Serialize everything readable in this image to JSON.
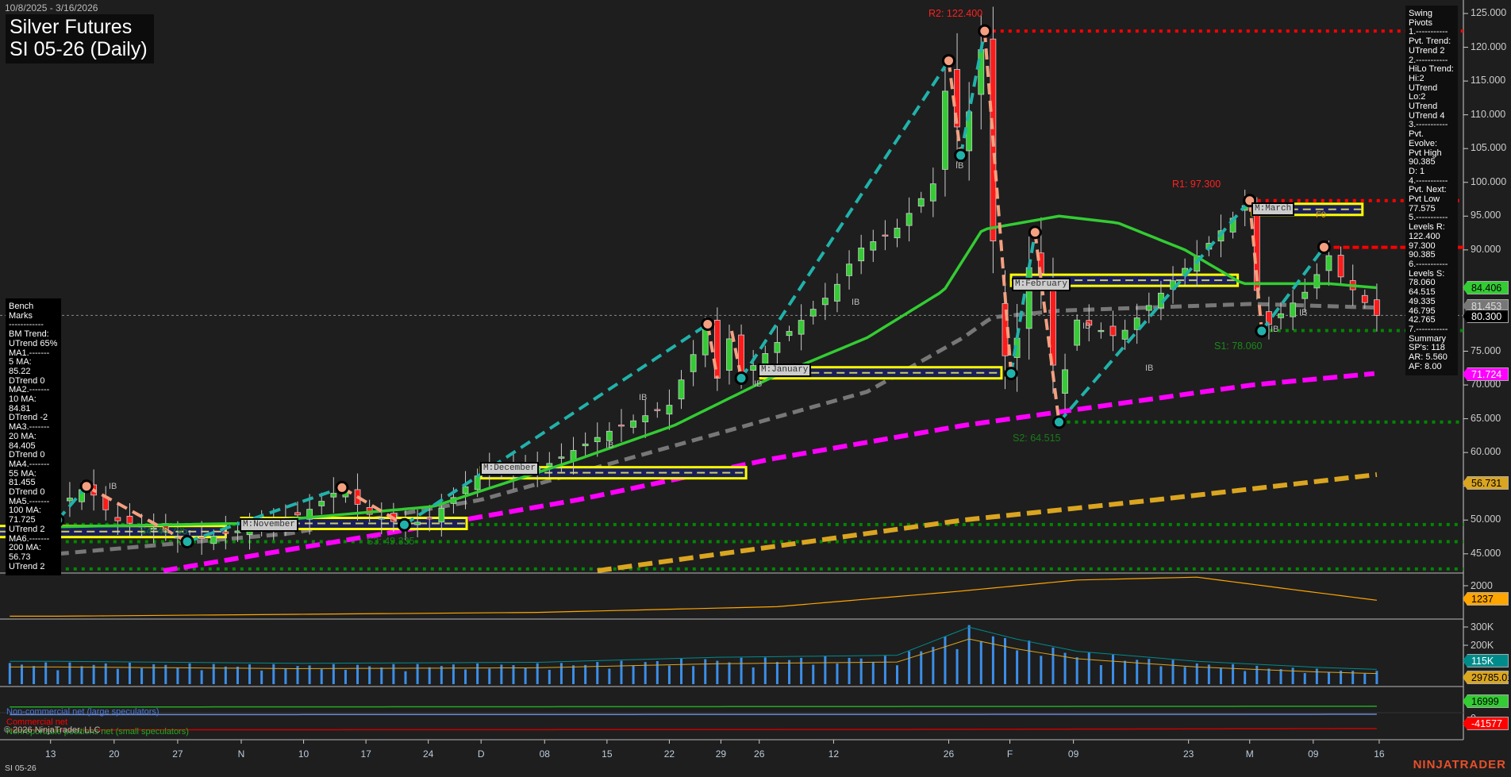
{
  "header": {
    "date_range": "10/8/2025 - 3/16/2026",
    "title": "Silver Futures",
    "subtitle": "SI 05-26 (Daily)"
  },
  "swing_pivots": [
    "Swing Pivots",
    "1.-----------",
    "Pvt. Trend:",
    "UTrend 2",
    "2.-----------",
    "HiLo Trend:",
    "Hi:2 UTrend",
    "Lo:2 UTrend",
    "UTrend 4",
    "3.-----------",
    "Pvt. Evolve:",
    "Pvt High",
    "90.385",
    "D: 1",
    "4.-----------",
    "Pvt. Next:",
    "Pvt Low",
    "77.575",
    "5.-----------",
    "Levels R:",
    "122.400",
    "97.300",
    "90.385",
    "6.-----------",
    "Levels S:",
    "78.060",
    "64.515",
    "49.335",
    "46.795",
    "42.765",
    "7.-----------",
    "Summary",
    "SP's: 118",
    "AR: 5.560",
    "AF: 8.00"
  ],
  "bench_marks": [
    "Bench Marks",
    "------------",
    "BM Trend:",
    "UTrend 65%",
    "MA1.-------",
    "5 MA:",
    "85.22",
    "DTrend 0",
    "MA2.-------",
    "10 MA:",
    "84.81",
    "DTrend -2",
    "MA3.-------",
    "20 MA:",
    "84.405",
    "DTrend 0",
    "MA4.-------",
    "55 MA:",
    "81.455",
    "DTrend 0",
    "MA5.-------",
    "100 MA:",
    "71.725",
    "UTrend 2",
    "MA6.-------",
    "200 MA:",
    "56.73",
    "UTrend 2"
  ],
  "level_labels": {
    "r2": "R2: 122.400",
    "r1": "R1: 97.300",
    "s1": "S1: 78.060",
    "s2": "S2: 64.515",
    "s3": "S3: 49.335",
    "s4": "S4: 46.795"
  },
  "month_boxes": {
    "nov": "M:November",
    "dec": "M:December",
    "jan": "M:January",
    "feb": "M:February",
    "mar": "M:March",
    "f0": "F0"
  },
  "ib_label": "IB",
  "price_axis": [
    "125.000",
    "120.000",
    "115.000",
    "110.000",
    "105.000",
    "100.000",
    "95.000",
    "90.000",
    "75.000",
    "70.000",
    "65.000",
    "60.000",
    "55.000",
    "50.000",
    "45.000"
  ],
  "indicator_axis": [
    "2000"
  ],
  "volume_axis": [
    "300K",
    "200K"
  ],
  "cot_axis": [
    "0"
  ],
  "price_tags": {
    "ma20": "84.406",
    "ma55": "81.453",
    "last": "80.300",
    "ma100": "71.724",
    "ma200": "56.731",
    "ind": "1237",
    "vol": "115K",
    "volavg": "29785.01",
    "nonrep": "16999",
    "comm": "-41577"
  },
  "legend": {
    "noncomm": "Non-commercial net (large speculators)",
    "comm": "Commercial net",
    "copyright": "© 2026 NinjaTrader, LLC",
    "nonrep": "Nonreportable positions net (small speculators)"
  },
  "x_axis": [
    {
      "i": -0.6,
      "t": "13"
    },
    {
      "i": 4.7,
      "t": "20"
    },
    {
      "i": 10,
      "t": "27"
    },
    {
      "i": 15.3,
      "t": "N"
    },
    {
      "i": 20.5,
      "t": "10"
    },
    {
      "i": 25.7,
      "t": "17"
    },
    {
      "i": 30.9,
      "t": "24"
    },
    {
      "i": 35.3,
      "t": "D"
    },
    {
      "i": 40.6,
      "t": "08"
    },
    {
      "i": 45.8,
      "t": "15"
    },
    {
      "i": 51,
      "t": "22"
    },
    {
      "i": 55.3,
      "t": "29"
    },
    {
      "i": 58.5,
      "t": "26"
    },
    {
      "i": 64.7,
      "t": "12"
    },
    {
      "i": 74.3,
      "t": "26"
    },
    {
      "i": 79.4,
      "t": "F"
    },
    {
      "i": 84.7,
      "t": "09"
    },
    {
      "i": 94.3,
      "t": "23"
    },
    {
      "i": 99.4,
      "t": "M"
    },
    {
      "i": 104.7,
      "t": "09"
    },
    {
      "i": 110.2,
      "t": "16"
    }
  ],
  "footer": {
    "instrument": "SI 05-26",
    "brand": "NINJATRADER"
  },
  "colors": {
    "up": "#33cc33",
    "down": "#ff1a1a",
    "ma20": "#33cc33",
    "ma55": "#777777",
    "ma100": "#ff00ff",
    "ma200": "#daa520",
    "swing_up": "#20b2aa",
    "swing_down": "#f4a080",
    "resistance": "#ff0000",
    "support": "#008800"
  },
  "chart_data": {
    "type": "candlestick",
    "title": "Silver Futures SI 05-26 (Daily)",
    "x_unit": "trading-day index from 10/8/2025",
    "ylim": [
      42,
      127
    ],
    "price_path": [
      [
        0,
        52
      ],
      [
        2.4,
        55
      ],
      [
        4.7,
        50
      ],
      [
        8.8,
        48.5
      ],
      [
        10,
        47.5
      ],
      [
        10.8,
        46.8
      ],
      [
        15.3,
        48.5
      ],
      [
        20.5,
        51
      ],
      [
        23.7,
        54.8
      ],
      [
        25.7,
        51
      ],
      [
        28.9,
        49.3
      ],
      [
        30.9,
        50
      ],
      [
        35.3,
        57
      ],
      [
        40.6,
        58
      ],
      [
        45.8,
        63
      ],
      [
        51,
        67
      ],
      [
        54.2,
        79
      ],
      [
        55,
        71
      ],
      [
        56.2,
        78
      ],
      [
        57,
        71
      ],
      [
        58.6,
        74
      ],
      [
        64.7,
        84
      ],
      [
        66.7,
        90
      ],
      [
        69.9,
        93
      ],
      [
        73.1,
        100
      ],
      [
        74.3,
        118
      ],
      [
        75.3,
        104
      ],
      [
        77.3,
        122.4
      ],
      [
        78.3,
        78
      ],
      [
        79.5,
        71.7
      ],
      [
        81.5,
        92.6
      ],
      [
        82.7,
        78
      ],
      [
        83.5,
        64.5
      ],
      [
        84.5,
        80
      ],
      [
        88.4,
        77
      ],
      [
        94.4,
        88
      ],
      [
        99.4,
        97.3
      ],
      [
        99.6,
        90
      ],
      [
        100.4,
        78
      ],
      [
        104.8,
        85
      ],
      [
        105.6,
        90.4
      ],
      [
        107,
        86
      ],
      [
        110,
        80.3
      ]
    ],
    "ma20": [
      [
        0,
        49
      ],
      [
        15.3,
        49.5
      ],
      [
        31.3,
        52
      ],
      [
        43.4,
        59
      ],
      [
        51.4,
        64
      ],
      [
        59.4,
        71
      ],
      [
        67.5,
        77
      ],
      [
        73.9,
        84
      ],
      [
        77.1,
        93
      ],
      [
        83.5,
        95
      ],
      [
        88.4,
        94
      ],
      [
        94,
        90
      ],
      [
        98.8,
        85
      ],
      [
        106,
        85
      ],
      [
        110,
        84.4
      ]
    ],
    "ma55": [
      [
        0,
        45
      ],
      [
        19.3,
        48
      ],
      [
        35.3,
        53
      ],
      [
        51.4,
        61
      ],
      [
        67.5,
        69
      ],
      [
        75.5,
        77
      ],
      [
        77.9,
        80
      ],
      [
        83.5,
        81
      ],
      [
        99.6,
        82
      ],
      [
        110,
        81.45
      ]
    ],
    "ma100": [
      [
        8.8,
        42.5
      ],
      [
        27.3,
        48
      ],
      [
        43.4,
        53
      ],
      [
        59.4,
        59
      ],
      [
        75.5,
        64
      ],
      [
        83.5,
        66
      ],
      [
        99.6,
        70
      ],
      [
        110,
        71.72
      ]
    ],
    "ma200": [
      [
        45,
        42.5
      ],
      [
        59.4,
        46
      ],
      [
        75.5,
        50
      ],
      [
        91.6,
        53
      ],
      [
        110,
        56.73
      ]
    ],
    "swing_up": [
      [
        [
          10.8,
          46.8
        ],
        [
          23.7,
          54.8
        ]
      ],
      [
        [
          28.9,
          49.3
        ],
        [
          54.2,
          79
        ]
      ],
      [
        [
          57,
          71
        ],
        [
          74.3,
          118
        ]
      ],
      [
        [
          75.3,
          104
        ],
        [
          77.3,
          122.4
        ]
      ],
      [
        [
          79.5,
          71.7
        ],
        [
          81.5,
          92.6
        ]
      ],
      [
        [
          83.5,
          64.5
        ],
        [
          99.4,
          97.3
        ]
      ],
      [
        [
          100.4,
          78
        ],
        [
          105.6,
          90.4
        ]
      ],
      [
        [
          0,
          50
        ],
        [
          2.4,
          55
        ]
      ]
    ],
    "swing_down": [
      [
        [
          2.4,
          55
        ],
        [
          10.8,
          46.8
        ]
      ],
      [
        [
          23.7,
          54.8
        ],
        [
          28.9,
          49.3
        ]
      ],
      [
        [
          54.2,
          79
        ],
        [
          55,
          71
        ]
      ],
      [
        [
          56.2,
          78
        ],
        [
          57,
          71
        ]
      ],
      [
        [
          74.3,
          118
        ],
        [
          75.3,
          104
        ]
      ],
      [
        [
          77.3,
          122.4
        ],
        [
          79.5,
          71.7
        ]
      ],
      [
        [
          81.5,
          92.6
        ],
        [
          83.5,
          64.5
        ]
      ],
      [
        [
          99.4,
          97.3
        ],
        [
          100.4,
          78
        ]
      ]
    ],
    "levels": [
      {
        "p": 122.4,
        "from": 77.3,
        "kind": "r"
      },
      {
        "p": 97.3,
        "from": 99.4,
        "kind": "r"
      },
      {
        "p": 90.385,
        "from": 105.6,
        "kind": "r"
      },
      {
        "p": 78.06,
        "from": 100.4,
        "kind": "s"
      },
      {
        "p": 64.515,
        "from": 83.5,
        "kind": "s"
      },
      {
        "p": 49.335,
        "from": 0,
        "kind": "s"
      },
      {
        "p": 46.795,
        "from": 0,
        "kind": "s"
      },
      {
        "p": 42.765,
        "from": 0,
        "kind": "s"
      }
    ],
    "month_ranges": [
      {
        "from": -5,
        "to": 14,
        "p": 48.3
      },
      {
        "from": 15.3,
        "to": 34.1,
        "p": 49.5
      },
      {
        "from": 35.3,
        "to": 57.4,
        "p": 57
      },
      {
        "from": 58.6,
        "to": 78.7,
        "p": 71.8
      },
      {
        "from": 79.5,
        "to": 98.4,
        "p": 85.5
      },
      {
        "from": 99.6,
        "to": 108.8,
        "p": 96
      }
    ],
    "indicator": [
      [
        0,
        400
      ],
      [
        40,
        600
      ],
      [
        60,
        900
      ],
      [
        75,
        1700
      ],
      [
        85,
        2300
      ],
      [
        95,
        2450
      ],
      [
        103,
        1800
      ],
      [
        110,
        1237
      ]
    ],
    "volume": [
      [
        0,
        90
      ],
      [
        20,
        80
      ],
      [
        40,
        85
      ],
      [
        55,
        110
      ],
      [
        70,
        120
      ],
      [
        76,
        260
      ],
      [
        80,
        200
      ],
      [
        85,
        140
      ],
      [
        95,
        90
      ],
      [
        105,
        60
      ],
      [
        110,
        50
      ]
    ],
    "cot": {
      "noncomm": [
        [
          0,
          -5000
        ],
        [
          110,
          -4000
        ]
      ],
      "nonrep": [
        [
          0,
          15000
        ],
        [
          110,
          16999
        ]
      ],
      "comm": [
        [
          0,
          -45000
        ],
        [
          70,
          -44000
        ],
        [
          110,
          -41577
        ]
      ]
    }
  }
}
